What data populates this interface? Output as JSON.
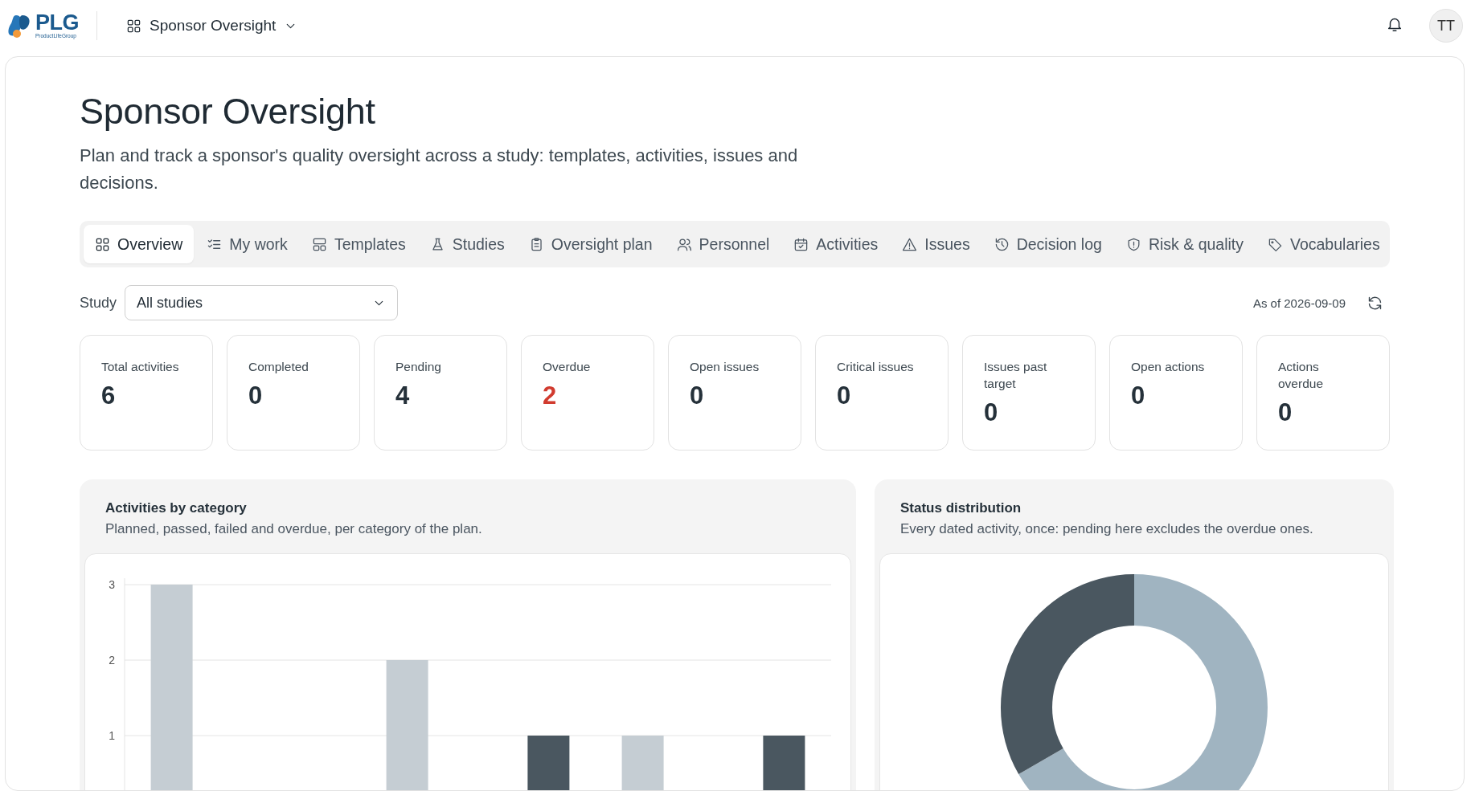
{
  "header": {
    "brand": "PLG",
    "brand_tagline": "ProductLifeGroup",
    "app_switcher": "Sponsor Oversight",
    "avatar": "TT"
  },
  "page": {
    "title": "Sponsor Oversight",
    "subtitle": "Plan and track a sponsor's quality oversight across a study: templates, activities, issues and decisions."
  },
  "tabs": [
    {
      "label": "Overview",
      "selected": true
    },
    {
      "label": "My work",
      "selected": false
    },
    {
      "label": "Templates",
      "selected": false
    },
    {
      "label": "Studies",
      "selected": false
    },
    {
      "label": "Oversight plan",
      "selected": false
    },
    {
      "label": "Personnel",
      "selected": false
    },
    {
      "label": "Activities",
      "selected": false
    },
    {
      "label": "Issues",
      "selected": false
    },
    {
      "label": "Decision log",
      "selected": false
    },
    {
      "label": "Risk & quality",
      "selected": false
    },
    {
      "label": "Vocabularies",
      "selected": false
    }
  ],
  "filter": {
    "label": "Study",
    "value": "All studies",
    "as_of": "As of 2026-09-09"
  },
  "stats": [
    {
      "label": "Total activities",
      "value": "6",
      "alert": false
    },
    {
      "label": "Completed",
      "value": "0",
      "alert": false
    },
    {
      "label": "Pending",
      "value": "4",
      "alert": false
    },
    {
      "label": "Overdue",
      "value": "2",
      "alert": true
    },
    {
      "label": "Open issues",
      "value": "0",
      "alert": false
    },
    {
      "label": "Critical issues",
      "value": "0",
      "alert": false
    },
    {
      "label": "Issues past target",
      "value": "0",
      "alert": false
    },
    {
      "label": "Open actions",
      "value": "0",
      "alert": false
    },
    {
      "label": "Actions overdue",
      "value": "0",
      "alert": false
    }
  ],
  "panels": [
    {
      "title": "Activities by category",
      "subtitle": "Planned, passed, failed and overdue, per category of the plan.",
      "chart_data": {
        "type": "bar",
        "ylim": [
          0,
          3
        ],
        "yticks": [
          1,
          2,
          3
        ],
        "series": [
          {
            "color": "#c5cdd3",
            "values": [
              3,
              2,
              1
            ]
          },
          {
            "values": [
              0,
              0,
              0
            ]
          },
          {
            "values": [
              0,
              0,
              0
            ]
          },
          {
            "color": "#4a5760",
            "values": [
              0,
              1,
              1
            ]
          }
        ]
      }
    },
    {
      "title": "Status distribution",
      "subtitle": "Every dated activity, once: pending here excludes the overdue ones.",
      "kind": "picture"
    }
  ]
}
